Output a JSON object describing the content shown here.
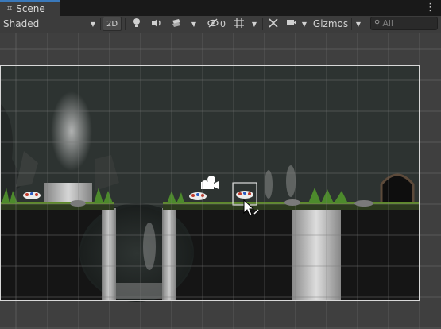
{
  "tab": {
    "icon": "grid-icon",
    "label": "Scene"
  },
  "window_menu_icon": "kebab-icon",
  "toolbar": {
    "shading_mode": "Shaded",
    "mode_2d_label": "2D",
    "hidden_count": "0",
    "gizmos_label": "Gizmos",
    "search_placeholder": "All",
    "icons": [
      "lightbulb-icon",
      "audio-icon",
      "effects-icon",
      "visibility-icon",
      "grid-snap-icon",
      "tools-icon",
      "camera-icon",
      "search-icon"
    ]
  },
  "colors": {
    "accent_tab": "#3a79bb",
    "toolbar_bg": "#3c3c3c",
    "scene_bg": "#3f3f3f"
  }
}
